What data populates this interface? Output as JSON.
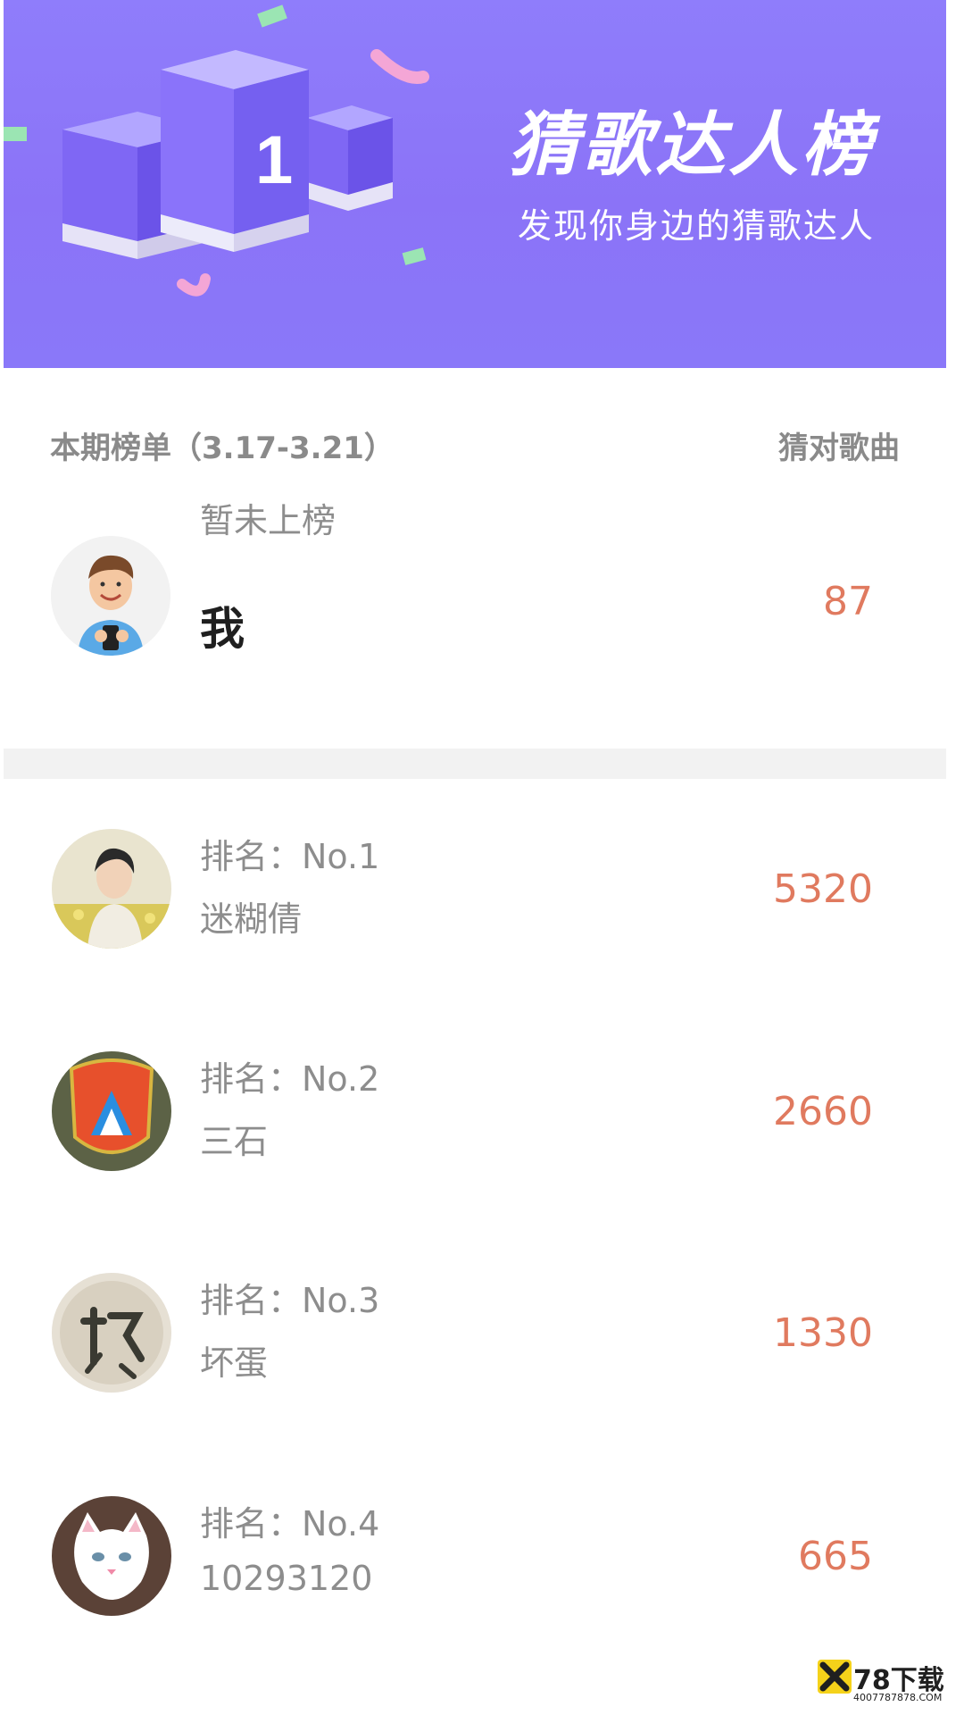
{
  "banner": {
    "title": "猜歌达人榜",
    "subtitle": "发现你身边的猜歌达人",
    "podium_number": "1"
  },
  "header": {
    "period_label": "本期榜单（3.17-3.21）",
    "column_label": "猜对歌曲"
  },
  "me": {
    "status": "暂未上榜",
    "name": "我",
    "score": "87"
  },
  "rankings": [
    {
      "rank_label": "排名：No.1",
      "name": "迷糊倩",
      "score": "5320"
    },
    {
      "rank_label": "排名：No.2",
      "name": "三石",
      "score": "2660"
    },
    {
      "rank_label": "排名：No.3",
      "name": "坏蛋",
      "score": "1330"
    },
    {
      "rank_label": "排名：No.4",
      "name": "10293120",
      "score": "665"
    }
  ],
  "watermark": {
    "brand": "78下载",
    "url": "4007787878.COM"
  },
  "colors": {
    "banner": "#8b73f7",
    "score": "#e07a5f",
    "muted_text": "#8d8d8d",
    "divider": "#f2f2f2"
  }
}
